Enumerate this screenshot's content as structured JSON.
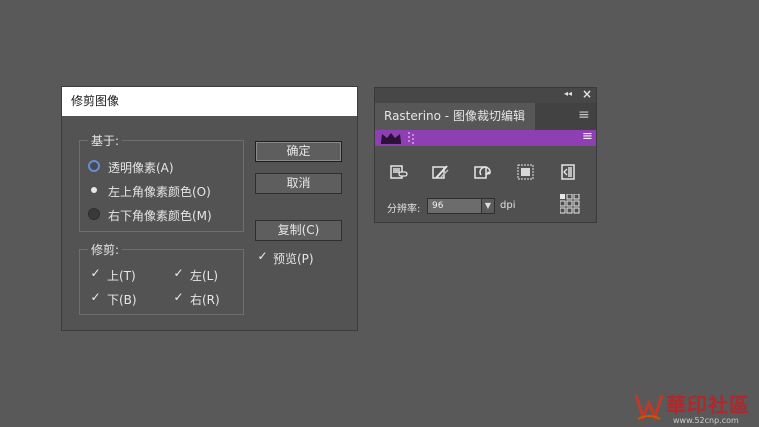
{
  "dialog": {
    "title": "修剪图像",
    "based_on": {
      "legend": "基于:",
      "options": [
        "透明像素(A)",
        "左上角像素颜色(O)",
        "右下角像素颜色(M)"
      ],
      "selected": "左上角像素颜色(O)"
    },
    "trim": {
      "legend": "修剪:",
      "top": {
        "label": "上(T)",
        "checked": true
      },
      "left": {
        "label": "左(L)",
        "checked": true
      },
      "bottom": {
        "label": "下(B)",
        "checked": true
      },
      "right": {
        "label": "右(R)",
        "checked": true
      }
    },
    "buttons": {
      "ok": "确定",
      "cancel": "取消",
      "copy": "复制(C)"
    },
    "preview": {
      "label": "预览(P)",
      "checked": true
    }
  },
  "panel": {
    "collapse_glyph": "◂◂",
    "close_glyph": "×",
    "tab_title": "Rasterino - 图像裁切编辑",
    "menu_glyph": "≡",
    "tools": [
      "link-image-icon",
      "edit-tools-icon",
      "rotate-image-icon",
      "crop-image-icon",
      "split-image-icon"
    ],
    "resolution_label": "分辨率:",
    "resolution_value": "96",
    "resolution_unit": "dpi",
    "colors": {
      "band": "#8e3fb2",
      "crown": "#2a1238"
    }
  },
  "watermark": {
    "logo_text": "華印社區",
    "url": "www.52cnp.com"
  }
}
